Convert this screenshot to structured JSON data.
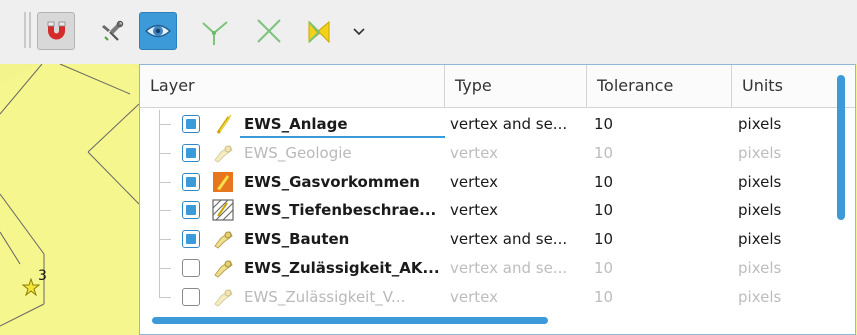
{
  "toolbar": {
    "buttons": [
      {
        "name": "snapping-toggle",
        "icon": "magnet-icon",
        "state": "checked"
      },
      {
        "name": "advanced-configuration",
        "icon": "snapping-settings-icon",
        "state": "normal"
      },
      {
        "name": "layer-visibility",
        "icon": "eye-icon",
        "state": "active"
      },
      {
        "name": "topological-editing",
        "icon": "topological-editing-icon",
        "state": "normal"
      },
      {
        "name": "snapping-on-intersection",
        "icon": "intersection-icon",
        "state": "normal"
      },
      {
        "name": "self-snapping",
        "icon": "self-snapping-icon",
        "state": "normal"
      }
    ],
    "more_icon": "chevron-down-icon"
  },
  "map": {
    "point_label": "3",
    "fill_color": "#f4f48c"
  },
  "panel": {
    "columns": {
      "layer": "Layer",
      "type": "Type",
      "tolerance": "Tolerance",
      "units": "Units"
    },
    "rows": [
      {
        "checked": true,
        "enabled": true,
        "name": "EWS_Anlage",
        "type": "vertex and se...",
        "tolerance": "10",
        "units": "pixels",
        "icon": "line-layer-icon"
      },
      {
        "checked": true,
        "enabled": false,
        "name": "EWS_Geologie",
        "type": "vertex",
        "tolerance": "10",
        "units": "pixels",
        "icon": "point-layer-icon"
      },
      {
        "checked": true,
        "enabled": true,
        "name": "EWS_Gasvorkommen",
        "type": "vertex",
        "tolerance": "10",
        "units": "pixels",
        "icon": "polygon-layer-icon"
      },
      {
        "checked": true,
        "enabled": true,
        "name": "EWS_Tiefenbeschrae...",
        "type": "vertex",
        "tolerance": "10",
        "units": "pixels",
        "icon": "hatched-polygon-layer-icon"
      },
      {
        "checked": true,
        "enabled": true,
        "name": "EWS_Bauten",
        "type": "vertex and se...",
        "tolerance": "10",
        "units": "pixels",
        "icon": "point-layer-icon"
      },
      {
        "checked": false,
        "enabled": "partial",
        "name": "EWS_Zulässigkeit_AK...",
        "type": "vertex and se...",
        "tolerance": "10",
        "units": "pixels",
        "icon": "point-layer-icon"
      },
      {
        "checked": false,
        "enabled": false,
        "name": "EWS_Zulässigkeit_V...",
        "type": "vertex",
        "tolerance": "10",
        "units": "pixels",
        "icon": "point-layer-icon"
      }
    ],
    "accent_color": "#3d9ad8"
  }
}
